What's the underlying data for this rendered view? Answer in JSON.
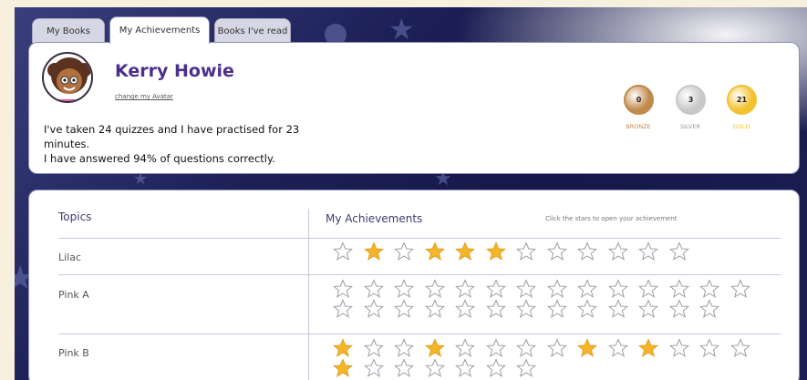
{
  "tabs": [
    {
      "label": "My Books",
      "active": false
    },
    {
      "label": "My Achievements",
      "active": true
    },
    {
      "label": "Books I've read",
      "active": false
    }
  ],
  "profile": {
    "name": "Kerry Howie",
    "change_avatar": "change my Avatar",
    "summary_line1": "I've taken 24 quizzes and I have practised for 23",
    "summary_line2": "minutes.",
    "summary_line3": "I have answered 94% of questions correctly."
  },
  "medals": [
    {
      "label": "BRONZE",
      "count": "0",
      "color": "#c08a4a"
    },
    {
      "label": "SILVER",
      "count": "3",
      "color": "#c8c8c8"
    },
    {
      "label": "GOLD",
      "count": "21",
      "color": "#f2c230"
    }
  ],
  "achievements_table": {
    "topics_header": "Topics",
    "achievements_header": "My Achievements",
    "hint": "Click the stars to open your achievement",
    "rows": [
      {
        "topic": "Lilac",
        "stars": [
          0,
          1,
          0,
          1,
          1,
          1,
          0,
          0,
          0,
          0,
          0,
          0
        ]
      },
      {
        "topic": "Pink A",
        "stars": [
          0,
          0,
          0,
          0,
          0,
          0,
          0,
          0,
          0,
          0,
          0,
          0,
          0,
          0,
          0,
          0,
          0,
          0,
          0,
          0,
          0,
          0,
          0,
          0,
          0,
          0,
          0
        ]
      },
      {
        "topic": "Pink B",
        "stars": [
          1,
          0,
          0,
          1,
          0,
          0,
          0,
          0,
          1,
          0,
          1,
          0,
          0,
          0,
          1,
          0,
          0,
          0,
          0,
          0,
          0
        ]
      }
    ]
  },
  "colors": {
    "accent": "#4b2f8d",
    "star_filled": "#f5b52a",
    "star_empty": "#9aa0a6"
  }
}
